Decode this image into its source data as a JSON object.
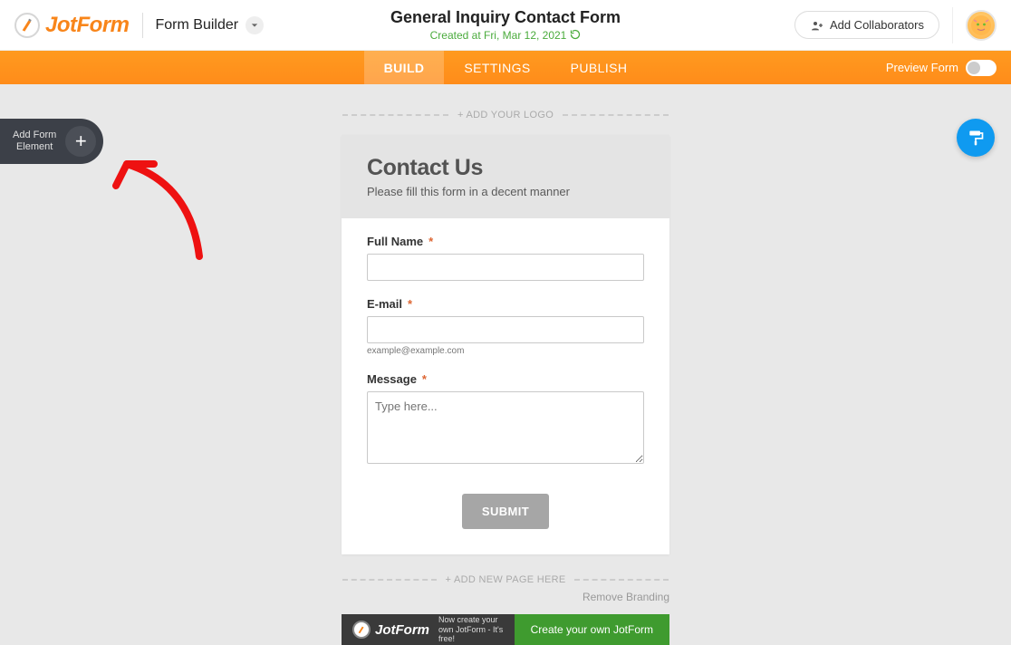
{
  "header": {
    "logo_text": "JotForm",
    "form_builder_label": "Form Builder",
    "page_title": "General Inquiry Contact Form",
    "created_text": "Created at Fri, Mar 12, 2021",
    "collaborators_label": "Add Collaborators"
  },
  "nav": {
    "tabs": [
      {
        "label": "BUILD",
        "active": true
      },
      {
        "label": "SETTINGS",
        "active": false
      },
      {
        "label": "PUBLISH",
        "active": false
      }
    ],
    "preview_label": "Preview Form"
  },
  "side": {
    "add_element_line1": "Add Form",
    "add_element_line2": "Element"
  },
  "canvas": {
    "add_logo_label": "+ ADD YOUR LOGO",
    "add_page_label": "+ ADD NEW PAGE HERE",
    "remove_branding_label": "Remove Branding"
  },
  "form": {
    "title": "Contact Us",
    "subtitle": "Please fill this form in a decent manner",
    "fields": {
      "fullname": {
        "label": "Full Name",
        "required": "*"
      },
      "email": {
        "label": "E-mail",
        "required": "*",
        "sublabel": "example@example.com"
      },
      "message": {
        "label": "Message",
        "required": "*",
        "placeholder": "Type here..."
      }
    },
    "submit_label": "SUBMIT"
  },
  "promo": {
    "logo_text": "JotForm",
    "message": "Now create your own JotForm - It's free!",
    "cta_label": "Create your own JotForm"
  }
}
